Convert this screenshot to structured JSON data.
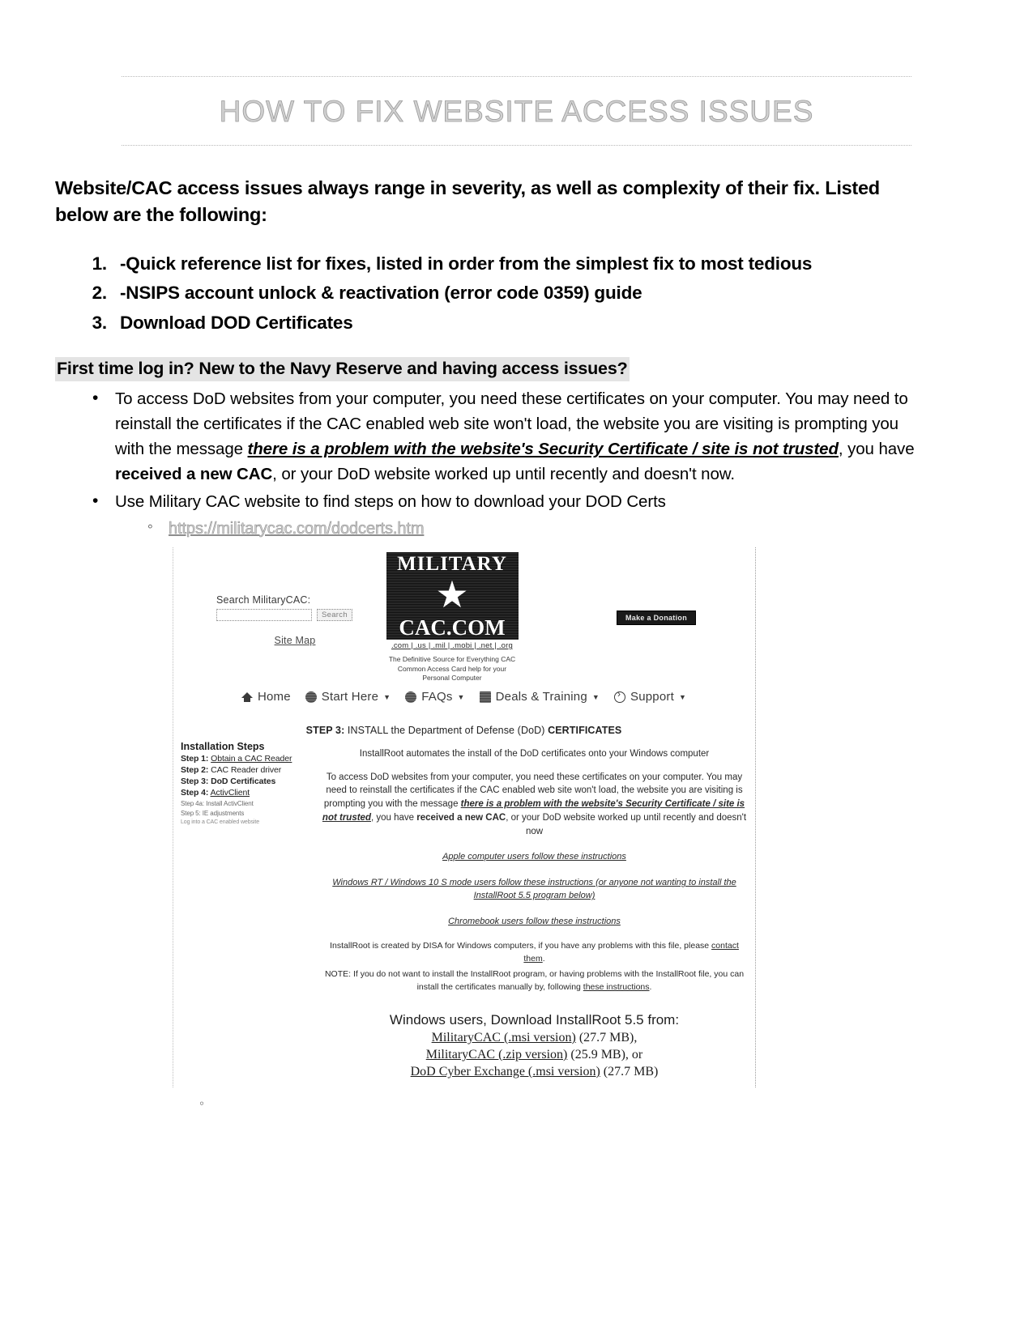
{
  "document": {
    "title": "HOW TO FIX WEBSITE ACCESS ISSUES",
    "lead": "Website/CAC access issues always range in severity, as well as complexity of their fix. Listed below are the following:",
    "numbered_items": [
      "-Quick reference list for fixes, listed in order from the simplest fix to most tedious",
      "-NSIPS account unlock & reactivation (error code 0359) guide",
      "Download DOD Certificates"
    ],
    "section_heading": "First time log in? New to the Navy Reserve and having access issues?",
    "bullet1": {
      "part1": "To access DoD websites from your computer, you need these certificates on your computer. You may need to reinstall the certificates if the CAC enabled web site won't load, the website you are visiting is prompting you with the message ",
      "italic_underline": "there is a problem with the website's Security Certificate / site is not trusted",
      "part2": ", you have ",
      "bold": "received a new CAC",
      "part3": ", or your DoD website worked up until recently and doesn't now."
    },
    "bullet2": "Use Military CAC website to find steps on how to download your DOD Certs",
    "sub_bullet_url": "https://militarycac.com/dodcerts.htm"
  },
  "screenshot": {
    "search": {
      "label": "Search MilitaryCAC:",
      "input_value": "",
      "input_placeholder": "",
      "button_label": "Search",
      "sitemap_label": "Site Map"
    },
    "logo": {
      "top_word": "MILITARY",
      "bottom_word": "CAC.COM",
      "star": "★",
      "tld_row": ".com | .us | .mil | .mobi | .net | .org",
      "tagline_line1": "The Definitive Source for Everything CAC",
      "tagline_line2": "Common Access Card help for your",
      "tagline_line3": "Personal Computer"
    },
    "donate_button": "Make a Donation",
    "nav_items": [
      {
        "label": "Home",
        "icon": "home-icon",
        "caret": false
      },
      {
        "label": "Start Here",
        "icon": "globe-icon",
        "caret": true
      },
      {
        "label": "FAQs",
        "icon": "globe-icon",
        "caret": true
      },
      {
        "label": "Deals & Training",
        "icon": "grid-icon",
        "caret": true
      },
      {
        "label": "Support",
        "icon": "arrow-circle-icon",
        "caret": true
      }
    ],
    "step_header": {
      "step_label": "STEP 3:",
      "middle": "  INSTALL the Department of Defense (DoD) ",
      "emphasis": "CERTIFICATES"
    },
    "sidebar": {
      "title": "Installation Steps",
      "steps": [
        {
          "label": "Step 1:",
          "text": "Obtain a CAC Reader",
          "link": true
        },
        {
          "label": "Step 2:",
          "text": "CAC Reader driver",
          "link": false
        },
        {
          "label": "Step 3:",
          "text": "DoD Certificates",
          "link": false
        },
        {
          "label": "Step 4:",
          "text": "ActivClient",
          "link": true
        }
      ],
      "substeps": [
        "Step 4a: Install ActivClient",
        "Step 5: IE adjustments",
        "Log into a CAC enabled website"
      ]
    },
    "main": {
      "intro_line1": "InstallRoot automates the install of the DoD certificates onto your Windows",
      "intro_line2": "computer",
      "para": {
        "part1": "To access DoD websites from your computer, you need these certificates on your computer.  You may need to reinstall the certificates if the CAC enabled web site won't load, the website you are visiting is prompting you with the message ",
        "emph": "there is a problem with the website's Security Certificate / site is not trusted",
        "part2": ", you have ",
        "bold": "received a new CAC",
        "part3": ", or your DoD website worked up until recently and doesn't now"
      },
      "link_apple": "Apple computer users follow these instructions",
      "link_windows_rt": "Windows RT / Windows 10 S mode users follow these instructions",
      "windows_rt_tail": " (or anyone not wanting to install the InstallRoot 5.5 program below)",
      "link_chromebook": "Chromebook users follow these instructions",
      "note1_part1": "InstallRoot is created by DISA for Windows computers, if you have any problems with this file, please ",
      "note1_link": "contact them",
      "note1_part2": ".",
      "note2_part1": "NOTE: If you do not want to install the InstallRoot program, or having problems with the InstallRoot file, you can install the certificates manually by, following ",
      "note2_link": "these instructions",
      "note2_part2": ".",
      "download_heading": "Windows users, Download InstallRoot 5.5 from:",
      "downloads": [
        {
          "link": "MilitaryCAC (.msi version)",
          "size": " (27.7 MB),"
        },
        {
          "link": "MilitaryCAC (.zip version)",
          "size": " (25.9 MB), or"
        },
        {
          "link": "DoD Cyber Exchange (.msi version)",
          "size": " (27.7 MB)"
        }
      ]
    }
  }
}
